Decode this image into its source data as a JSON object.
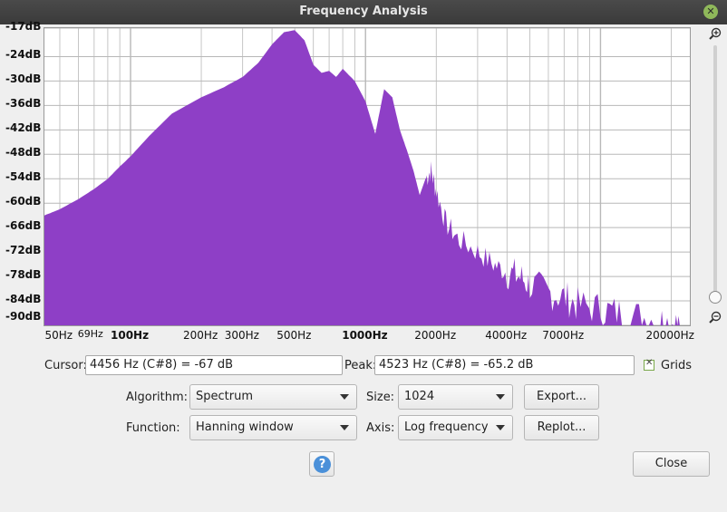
{
  "window": {
    "title": "Frequency Analysis"
  },
  "plot": {
    "y_ticks": [
      "-17dB",
      "-24dB",
      "-30dB",
      "-36dB",
      "-42dB",
      "-48dB",
      "-54dB",
      "-60dB",
      "-66dB",
      "-72dB",
      "-78dB",
      "-84dB",
      "-90dB"
    ],
    "x_ticks": [
      {
        "label": "50Hz",
        "hz": 50,
        "bold": false
      },
      {
        "label": "69Hz",
        "hz": 69,
        "bold": false
      },
      {
        "label": "100Hz",
        "hz": 100,
        "bold": true
      },
      {
        "label": "200Hz",
        "hz": 200,
        "bold": false
      },
      {
        "label": "300Hz",
        "hz": 300,
        "bold": false
      },
      {
        "label": "500Hz",
        "hz": 500,
        "bold": false
      },
      {
        "label": "1000Hz",
        "hz": 1000,
        "bold": true
      },
      {
        "label": "2000Hz",
        "hz": 2000,
        "bold": false
      },
      {
        "label": "4000Hz",
        "hz": 4000,
        "bold": false
      },
      {
        "label": "7000Hz",
        "hz": 7000,
        "bold": false
      },
      {
        "label": "20000Hz",
        "hz": 20000,
        "bold": false
      }
    ],
    "fill_color": "#8e3fc6",
    "grid_color": "#b8b8b8"
  },
  "chart_data": {
    "type": "area",
    "x_scale": "log",
    "xlim": [
      43,
      24000
    ],
    "ylim": [
      -90,
      -17
    ],
    "grid": true,
    "x": [
      43,
      50,
      60,
      70,
      80,
      90,
      100,
      120,
      150,
      200,
      250,
      300,
      350,
      400,
      450,
      500,
      550,
      600,
      650,
      700,
      750,
      800,
      900,
      1000,
      1100,
      1200,
      1300,
      1400,
      1500,
      1600,
      1700,
      1800,
      1900,
      2000,
      2200,
      2500,
      3000,
      3500,
      4000,
      4500,
      5000,
      6000,
      7000,
      8000,
      10000,
      12000,
      15000,
      18000,
      20000,
      22000
    ],
    "y": [
      -63,
      -61.5,
      -59,
      -56.5,
      -54,
      -51,
      -48.5,
      -43.5,
      -38,
      -34,
      -31.5,
      -29,
      -25.5,
      -21,
      -18,
      -17.5,
      -20,
      -26,
      -28,
      -27.5,
      -29,
      -27,
      -30,
      -35,
      -43,
      -32,
      -34,
      -42,
      -47,
      -52,
      -58,
      -54,
      -52,
      -57,
      -65,
      -69,
      -72,
      -75,
      -77,
      -78,
      -80,
      -82,
      -83,
      -85,
      -86,
      -87,
      -88,
      -89,
      -89.5,
      -90
    ]
  },
  "cursor": {
    "label": "Cursor:",
    "value": "4456 Hz (C#8) = -67 dB"
  },
  "peak": {
    "label": "Peak:",
    "value": "4523 Hz (C#8) = -65.2 dB"
  },
  "grids": {
    "label": "Grids",
    "checked": true
  },
  "algorithm": {
    "label": "Algorithm:",
    "value": "Spectrum"
  },
  "function": {
    "label": "Function:",
    "value": "Hanning window"
  },
  "size": {
    "label": "Size:",
    "value": "1024"
  },
  "axis": {
    "label": "Axis:",
    "value": "Log frequency"
  },
  "buttons": {
    "export": "Export...",
    "replot": "Replot...",
    "close": "Close",
    "help": "?"
  },
  "icons": {
    "zoom_in": "zoom-in-icon",
    "zoom_out": "zoom-out-icon",
    "close": "close-icon",
    "help": "help-icon"
  }
}
